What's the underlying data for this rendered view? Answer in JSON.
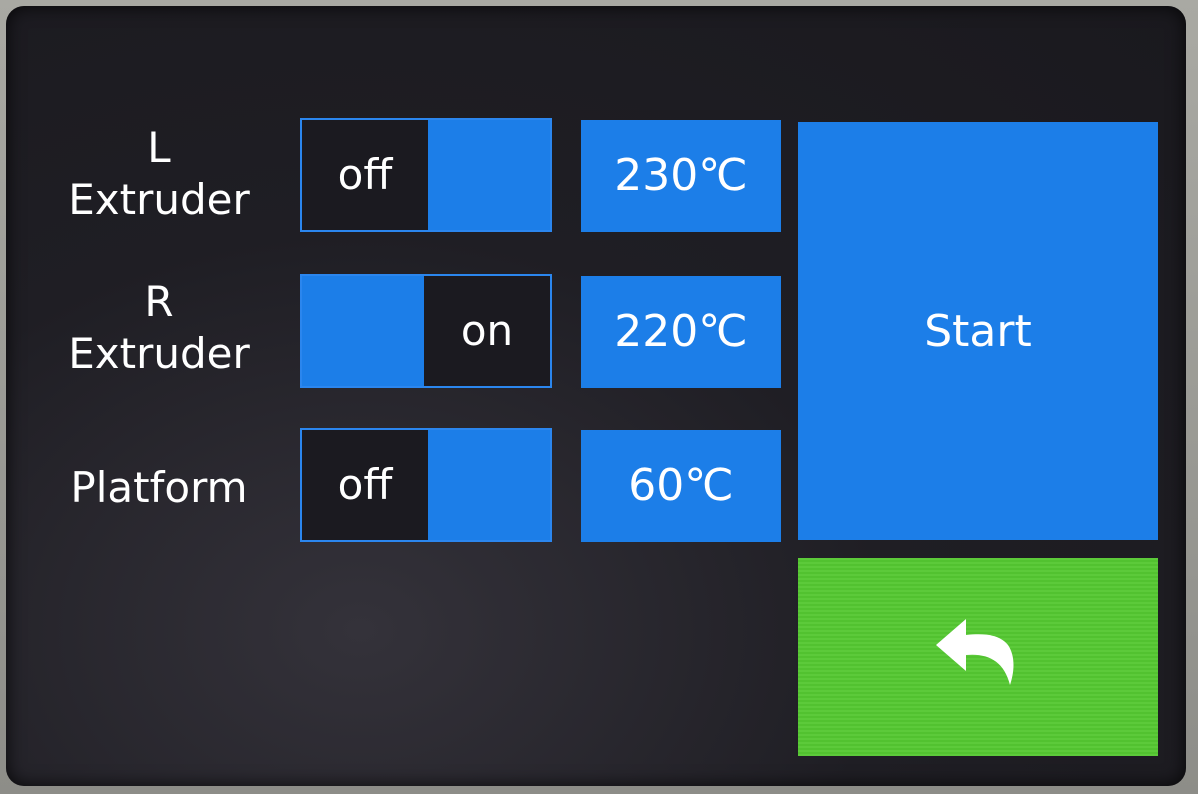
{
  "rows": [
    {
      "label_line1": "L",
      "label_line2": "Extruder",
      "state": "off",
      "temperature": "230℃"
    },
    {
      "label_line1": "R",
      "label_line2": "Extruder",
      "state": "on",
      "temperature": "220℃"
    },
    {
      "label": "Platform",
      "state": "off",
      "temperature": "60℃"
    }
  ],
  "start_label": "Start",
  "back_icon": "back-arrow-icon",
  "colors": {
    "blue": "#1c7ee8",
    "green": "#55c832",
    "background": "#1b1a20",
    "text": "#ffffff"
  }
}
